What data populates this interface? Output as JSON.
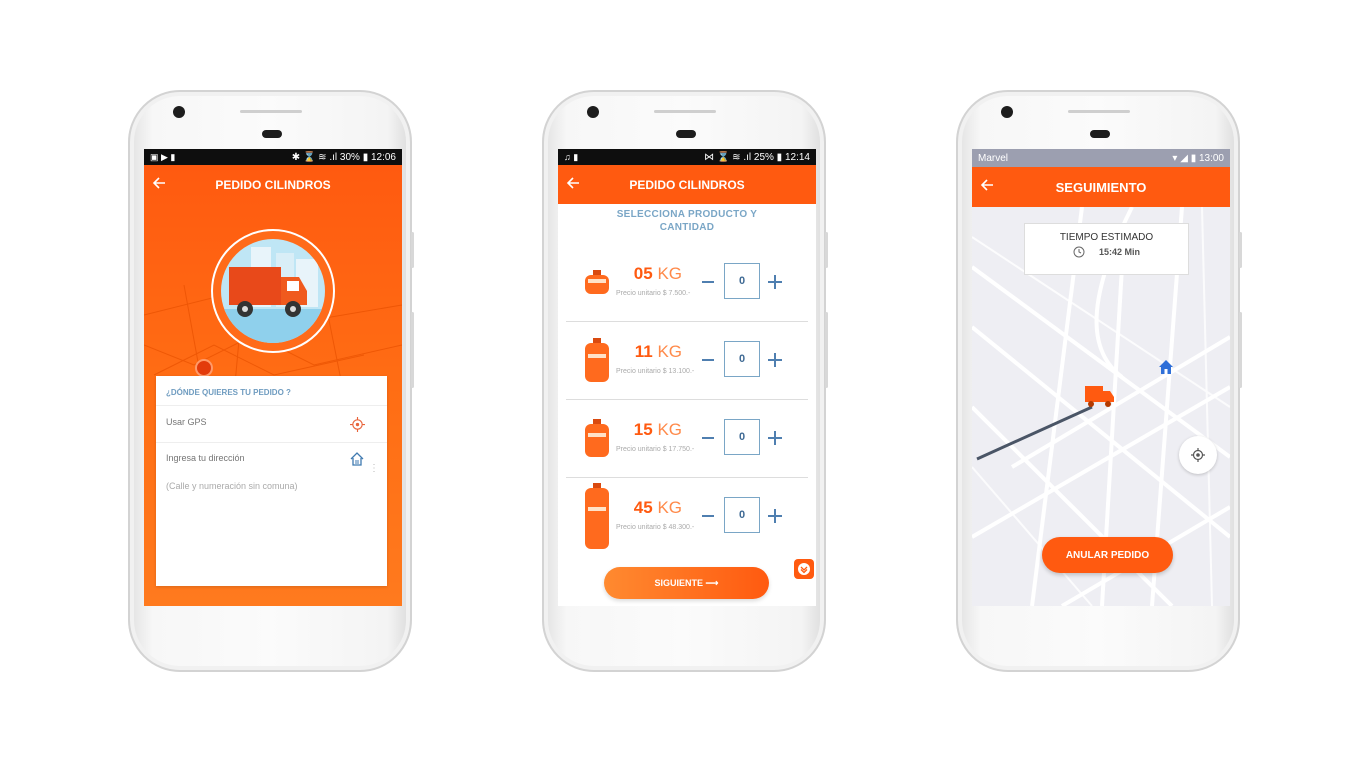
{
  "phone1": {
    "status_right": "✱ ⌛ ≋ .ıl 30% ▮ 12:06",
    "title": "PEDIDO CILINDROS",
    "card_title": "¿DÓNDE QUIERES TU PEDIDO ?",
    "gps_placeholder": "Usar GPS",
    "address_placeholder": "Ingresa tu dirección",
    "address_hint": "(Calle y numeración sin comuna)"
  },
  "phone2": {
    "status_right": "⋈ ⌛ ≋ .ıl 25% ▮ 12:14",
    "title": "PEDIDO CILINDROS",
    "heading": "SELECCIONA PRODUCTO Y CANTIDAD",
    "products": [
      {
        "weight": "05",
        "unit": "KG",
        "price": "Precio unitario $ 7.500.-",
        "qty": "0"
      },
      {
        "weight": "11",
        "unit": "KG",
        "price": "Precio unitario $ 13.100.-",
        "qty": "0"
      },
      {
        "weight": "15",
        "unit": "KG",
        "price": "Precio unitario $ 17.750.-",
        "qty": "0"
      },
      {
        "weight": "45",
        "unit": "KG",
        "price": "Precio unitario $ 48.300.-",
        "qty": "0"
      }
    ],
    "next_label": "SIGUIENTE ⟶"
  },
  "phone3": {
    "carrier": "Marvel",
    "status_right": "▾ ◢ ▮ 13:00",
    "title": "SEGUIMIENTO",
    "eta_label": "TIEMPO ESTIMADO",
    "eta_value": "15:42 Min",
    "cancel_label": "ANULAR PEDIDO"
  },
  "colors": {
    "accent": "#ff5a10",
    "heading_blue": "#7aa6c6"
  }
}
